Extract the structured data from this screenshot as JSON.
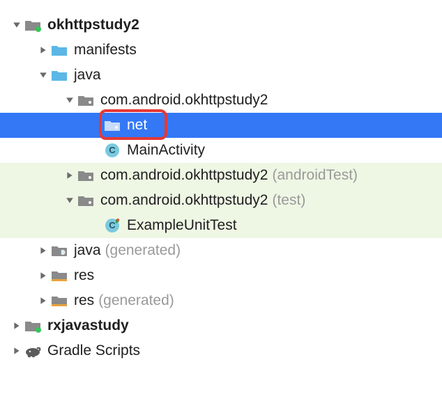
{
  "tree": {
    "root_partial": "",
    "okhttpstudy2": "okhttpstudy2",
    "manifests": "manifests",
    "java": "java",
    "pkg_main": "com.android.okhttpstudy2",
    "net": "net",
    "main_activity": "MainActivity",
    "pkg_android_test": "com.android.okhttpstudy2",
    "pkg_android_test_suffix": "(androidTest)",
    "pkg_test": "com.android.okhttpstudy2",
    "pkg_test_suffix": "(test)",
    "example_unit_test": "ExampleUnitTest",
    "java_generated": "java",
    "java_generated_suffix": "(generated)",
    "res": "res",
    "res_generated": "res",
    "res_generated_suffix": "(generated)",
    "rxjavastudy": "rxjavastudy",
    "gradle_scripts": "Gradle Scripts"
  },
  "icons": {
    "class_letter": "C",
    "class_letter_run": "C"
  },
  "colors": {
    "selection": "#3478F6",
    "test_bg": "#eef7e4",
    "highlight_border": "#e53935"
  }
}
